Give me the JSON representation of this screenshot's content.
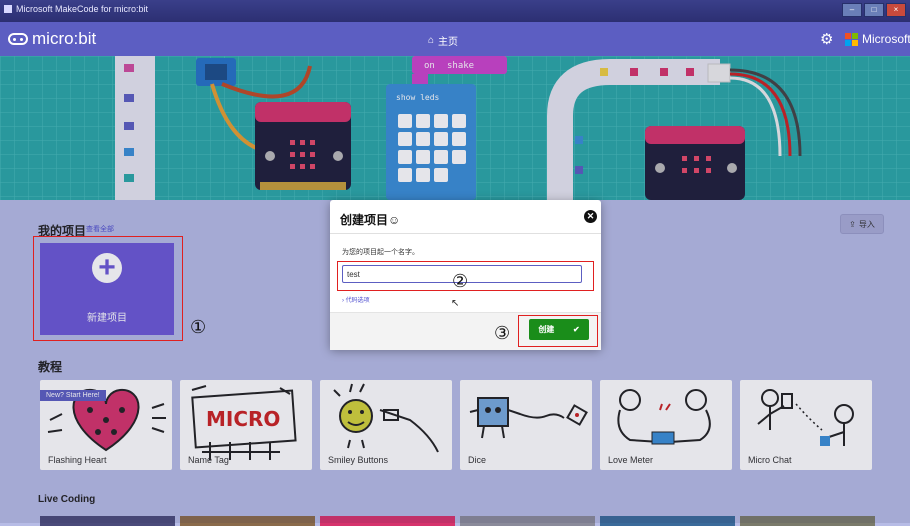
{
  "window": {
    "title": "Microsoft MakeCode for micro:bit"
  },
  "header": {
    "logo": "micro:bit",
    "home_label": "主页",
    "brand": "Microsoft",
    "home_icon": "home-icon",
    "settings_icon": "gear-icon"
  },
  "hero": {
    "block_on": "on",
    "block_shake": "shake",
    "block_show_leds": "show leds"
  },
  "projects": {
    "title": "我的项目",
    "view_all": "查看全部",
    "import_label": "导入",
    "new_project": "新建项目"
  },
  "tutorials": {
    "title": "教程",
    "ribbon": "New? Start Here!",
    "items": [
      {
        "label": "Flashing Heart"
      },
      {
        "label": "Name Tag"
      },
      {
        "label": "Smiley Buttons"
      },
      {
        "label": "Dice"
      },
      {
        "label": "Love Meter"
      },
      {
        "label": "Micro Chat"
      }
    ]
  },
  "live_coding": {
    "title": "Live Coding"
  },
  "dialog": {
    "title": "创建项目",
    "prompt": "为您的项目起一个名字。",
    "input_value": "test",
    "code_options": "代码选项",
    "create_label": "创建"
  },
  "annotations": {
    "step1": "①",
    "step2": "②",
    "step3": "③"
  },
  "colors": {
    "header": "#5c5ec2",
    "accent": "#6c58d6",
    "create": "#1a8d1a",
    "highlight": "#e02020"
  }
}
